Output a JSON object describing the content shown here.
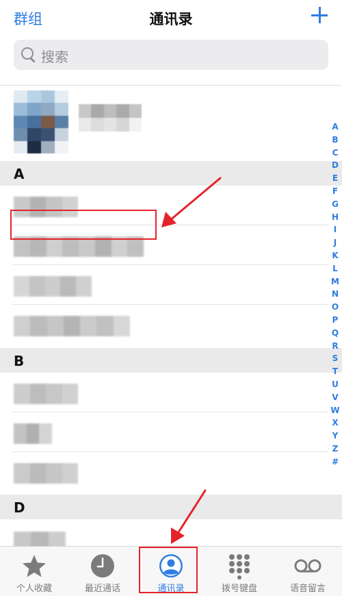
{
  "nav": {
    "left_label": "群组",
    "title": "通讯录"
  },
  "search": {
    "placeholder": "搜索"
  },
  "sections": [
    {
      "letter": "A"
    },
    {
      "letter": "B"
    },
    {
      "letter": "D"
    }
  ],
  "index_letters": [
    "A",
    "B",
    "C",
    "D",
    "E",
    "F",
    "G",
    "H",
    "I",
    "J",
    "K",
    "L",
    "M",
    "N",
    "O",
    "P",
    "Q",
    "R",
    "S",
    "T",
    "U",
    "V",
    "W",
    "X",
    "Y",
    "Z",
    "#"
  ],
  "tabs": [
    {
      "label": "个人收藏",
      "icon": "star-icon"
    },
    {
      "label": "最近通话",
      "icon": "clock-icon"
    },
    {
      "label": "通讯录",
      "icon": "contacts-icon",
      "active": true
    },
    {
      "label": "拨号键盘",
      "icon": "keypad-icon"
    },
    {
      "label": "语音留言",
      "icon": "voicemail-icon"
    }
  ],
  "colors": {
    "accent": "#2f7de1",
    "annotation": "#e3242b"
  }
}
